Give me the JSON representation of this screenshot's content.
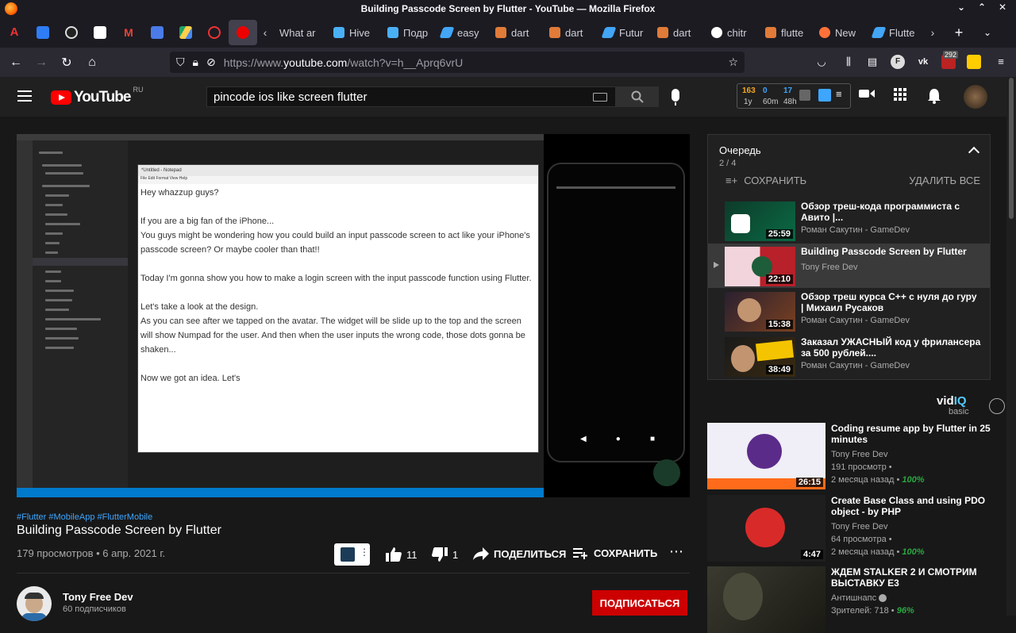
{
  "window_title": "Building Passcode Screen by Flutter - YouTube — Mozilla Firefox",
  "tabs": [
    "What ar",
    "Hive",
    "Подр",
    "easy",
    "dart",
    "dart",
    "Futur",
    "dart",
    "chitr",
    "flutte",
    "New",
    "Flutte"
  ],
  "url": {
    "prefix": "https://www.",
    "host": "youtube.com",
    "path": "/watch?v=h__Aprq6vrU"
  },
  "toolbar_badge": "292",
  "header": {
    "logo": "YouTube",
    "region": "RU",
    "search_value": "pincode ios like screen flutter",
    "vidiq_stats": {
      "a": "163",
      "a_label": "1y",
      "b": "0",
      "b_label": "60m",
      "c": "17",
      "c_label": "48h"
    }
  },
  "player": {
    "notepad_title": "*Untitled - Notepad",
    "notepad_menu": "File  Edit  Format  View  Help",
    "notepad_paragraphs": [
      "Hey whazzup guys?",
      "If you are a big fan of the iPhone...\nYou guys might be wondering how you could build an input passcode screen to act like your iPhone's passcode screen? Or maybe cooler than that!!",
      "Today I'm gonna show you how to make a login screen with the input passcode function using Flutter.",
      "Let's take a look at the design.\nAs you can see after we tapped on the avatar. The widget will be slide up to the top and the screen will show Numpad for the user. And then when the user inputs the wrong code, those dots gonna be shaken...",
      "Now we got an idea. Let's"
    ]
  },
  "video": {
    "hashtags": "#Flutter #MobileApp #FlutterMobile",
    "title": "Building Passcode Screen by Flutter",
    "meta": "179 просмотров • 6 апр. 2021 г.",
    "likes": "11",
    "dislikes": "1",
    "share": "ПОДЕЛИТЬСЯ",
    "save": "СОХРАНИТЬ"
  },
  "channel": {
    "name": "Tony Free Dev",
    "subs": "60 подписчиков",
    "subscribe": "ПОДПИСАТЬСЯ"
  },
  "queue": {
    "title": "Очередь",
    "position": "2 / 4",
    "save": "СОХРАНИТЬ",
    "clear": "УДАЛИТЬ ВСЕ",
    "items": [
      {
        "title": "Обзор треш-кода программиста с Авито |...",
        "channel": "Роман Сакутин - GameDev",
        "duration": "25:59"
      },
      {
        "title": "Building Passcode Screen by Flutter",
        "channel": "Tony Free Dev",
        "duration": "22:10"
      },
      {
        "title": "Обзор треш курса C++ с нуля до гуру | Михаил Русаков",
        "channel": "Роман Сакутин - GameDev",
        "duration": "15:38"
      },
      {
        "title": "Заказал УЖАСНЫЙ код у фрилансера за 500 рублей....",
        "channel": "Роман Сакутин - GameDev",
        "duration": "38:49"
      }
    ]
  },
  "vidiq": {
    "logo_a": "vid",
    "logo_b": "IQ",
    "plan": "basic"
  },
  "recommendations": [
    {
      "title": "Coding resume app by Flutter in 25 minutes",
      "channel": "Tony Free Dev",
      "views": "191 просмотр •",
      "age": "2 месяца назад •",
      "pct": "100%",
      "duration": "26:15"
    },
    {
      "title": "Create Base Class and using PDO object - by PHP",
      "channel": "Tony Free Dev",
      "views": "64 просмотра •",
      "age": "2 месяца назад •",
      "pct": "100%",
      "duration": "4:47"
    },
    {
      "title": "ЖДЕМ STALKER 2 И СМОТРИМ ВЫСТАВКУ E3",
      "channel": "Антишнапс",
      "views": "Зрителей: 718 •",
      "age": "",
      "pct": "96%",
      "duration": ""
    }
  ]
}
